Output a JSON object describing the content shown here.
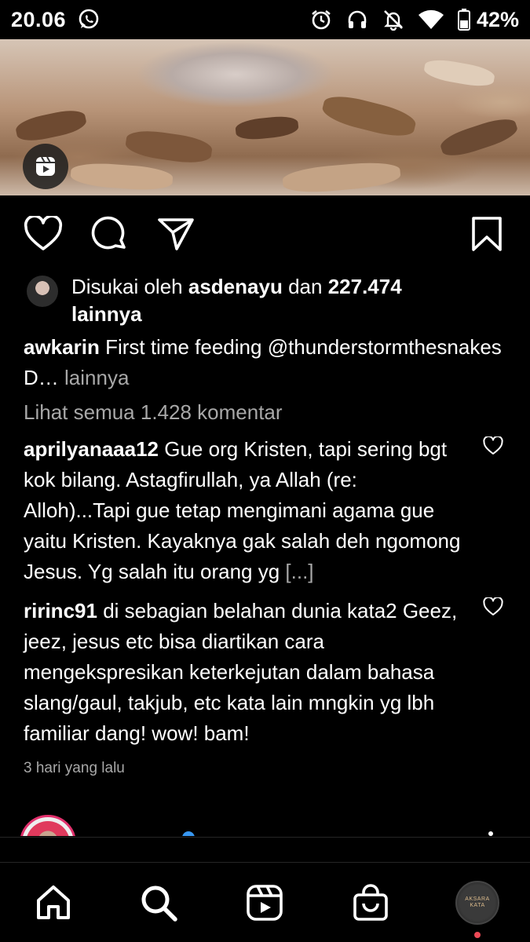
{
  "status_bar": {
    "time": "20.06",
    "battery": "42%",
    "icons": [
      "whatsapp-icon",
      "alarm-icon",
      "headphones-icon",
      "bell-off-icon",
      "wifi-icon",
      "battery-icon"
    ]
  },
  "post": {
    "media_badge_icon": "reels-icon",
    "actions": [
      "heart-icon",
      "comment-icon",
      "send-icon",
      "bookmark-icon"
    ],
    "likes": {
      "prefix": "Disukai oleh",
      "user": "asdenayu",
      "connector": "dan",
      "count": "227.474",
      "suffix": "lainnya"
    },
    "caption": {
      "username": "awkarin",
      "text": "First time feeding @thunderstormthesnakes D…",
      "more": "lainnya"
    },
    "view_all_comments": "Lihat semua 1.428 komentar",
    "comments": [
      {
        "username": "aprilyanaaa12",
        "text": "Gue org Kristen, tapi sering bgt kok bilang. Astagfirullah, ya Allah (re: Alloh)...Tapi gue tetap mengimani agama gue yaitu Kristen. Kayaknya gak salah deh ngomong Jesus. Yg salah itu orang yg",
        "truncation": "[...]"
      },
      {
        "username": "ririnc91",
        "text": "di sebagian belahan dunia kata2 Geez, jeez, jesus etc bisa diartikan cara mengekspresikan keterkejutan dalam bahasa slang/gaul, takjub, etc kata lain mngkin yg lbh familiar dang! wow! bam!",
        "truncation": ""
      }
    ],
    "timestamp": "3 hari yang lalu"
  },
  "bottom_nav": {
    "items": [
      "home-icon",
      "search-icon",
      "reels-icon",
      "shop-icon",
      "profile-avatar"
    ],
    "profile_avatar_text": "AKSARA KATA"
  },
  "colors": {
    "background": "#000000",
    "muted_text": "#a8a8a8",
    "notification": "#ed4956",
    "story_ring": "#e1306c"
  }
}
